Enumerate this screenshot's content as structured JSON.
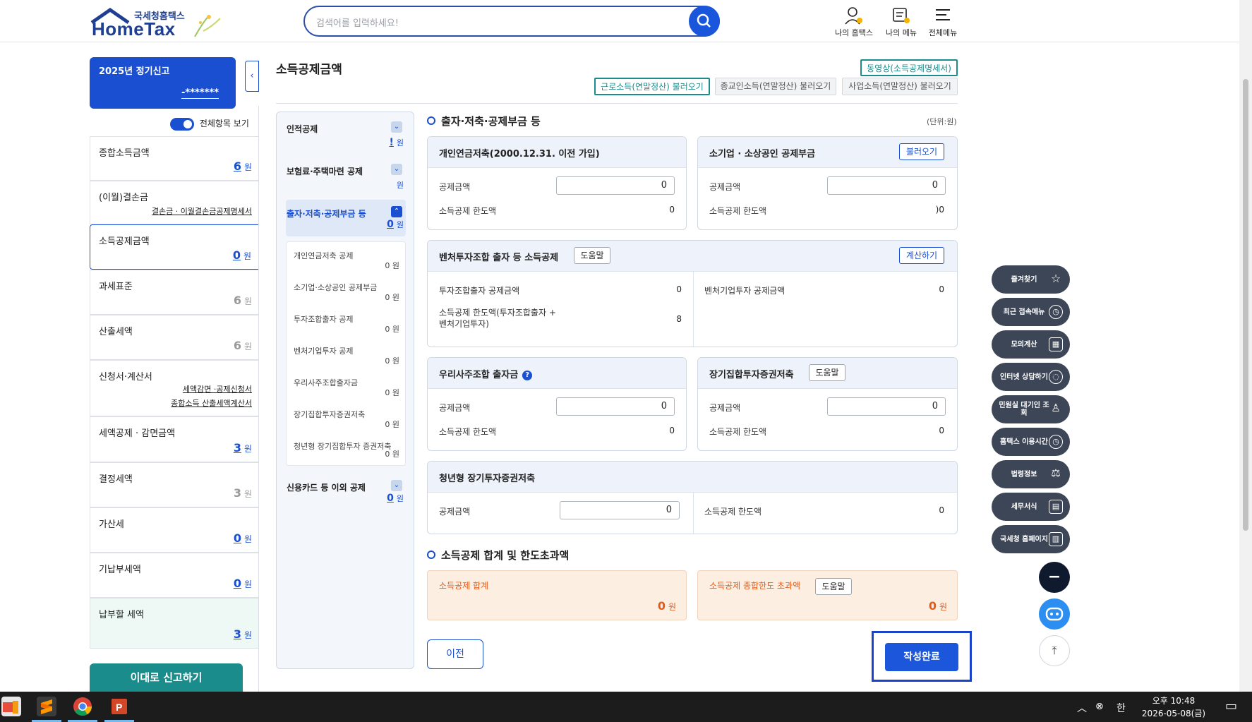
{
  "header": {
    "logo_small": "국세청홈택스",
    "logo_big": "HomeTax",
    "search_placeholder": "검색어를 입력하세요!",
    "icons": [
      {
        "name": "my-hometax-icon",
        "label": "나의 홈택스"
      },
      {
        "name": "my-menu-icon",
        "label": "나의 메뉴"
      },
      {
        "name": "all-menu-icon",
        "label": "전체메뉴"
      }
    ]
  },
  "sidebar": {
    "card_title": "2025년 정기신고",
    "card_masked": "-*******",
    "collapse_glyph": "‹",
    "toggle_label": "전체항목 보기",
    "won": "원",
    "items": [
      {
        "label": "종합소득금액",
        "value": "6"
      },
      {
        "label": "(이월)결손금",
        "link": "결손금 · 이월결손금공제명세서"
      },
      {
        "label": "소득공제금액",
        "value": "0"
      },
      {
        "label": "과세표준",
        "value": "6"
      },
      {
        "label": "산출세액",
        "value": "6"
      },
      {
        "label": "신청서·계산서",
        "link1": "세액감면 ·공제신청서",
        "link2": "종합소득 산출세액계산서"
      },
      {
        "label": "세액공제 · 감면금액",
        "value": "3"
      },
      {
        "label": "결정세액",
        "value": "3"
      },
      {
        "label": "가산세",
        "value": "0"
      },
      {
        "label": "기납부세액",
        "value": "0"
      },
      {
        "label": "납부할 세액",
        "value": "3"
      }
    ],
    "report_button": "이대로 신고하기"
  },
  "main": {
    "title": "소득공제금액",
    "video_button": "동영상(소득공제명세서)",
    "load_buttons": [
      "근로소득(연말정산) 불러오기",
      "종교인소득(연말정산) 불러오기",
      "사업소득(연말정산) 불러오기"
    ],
    "unit": "(단위:원)",
    "section1_title": "출자·저축·공제부금 등",
    "section2_title": "소득공제 합계 및 한도초과액",
    "boxes": {
      "pension": {
        "title": "개인연금저축(2000.12.31. 이전 가입)",
        "amount_label": "공제금액",
        "amount": "0",
        "limit_label": "소득공제 한도액",
        "limit": "0"
      },
      "small_biz": {
        "title": "소기업 · 소상공인 공제부금",
        "button": "불러오기",
        "amount_label": "공제금액",
        "amount": "0",
        "limit_label": "소득공제 한도액",
        "limit": ")0"
      },
      "venture": {
        "title": "벤처투자조합 출자 등 소득공제",
        "help": "도움말",
        "calc": "계산하기",
        "invest_label": "투자조합출자 공제금액",
        "invest": "0",
        "venture_label": "벤처기업투자 공제금액",
        "venture_val": "0",
        "limit_label": "소득공제 한도액(투자조합출자 + 벤처기업투자)",
        "limit": "8"
      },
      "esop": {
        "title": "우리사주조합 출자금",
        "help_glyph": "?",
        "amount_label": "공제금액",
        "amount": "0",
        "limit_label": "소득공제 한도액",
        "limit": "0"
      },
      "longterm": {
        "title": "장기집합투자증권저축",
        "help": "도움말",
        "amount_label": "공제금액",
        "amount": "0",
        "limit_label": "소득공제 한도액",
        "limit": "0"
      },
      "youth": {
        "title": "청년형 장기투자증권저축",
        "amount_label": "공제금액",
        "amount": "0",
        "limit_label": "소득공제 한도액",
        "limit": "0"
      }
    },
    "total": {
      "label": "소득공제 합계",
      "value": "0",
      "unit": "원"
    },
    "excess": {
      "label": "소득공제 종합한도 초과액",
      "help": "도움말",
      "value": "0",
      "unit": "원"
    },
    "prev_button": "이전",
    "done_button": "작성완료"
  },
  "midpanel": {
    "sections": [
      {
        "label": "인적공제",
        "value": "!",
        "unit": "원"
      },
      {
        "label": "보험료·주택마련 공제",
        "value": "",
        "unit": "원"
      },
      {
        "label": "출자·저축·공제부금 등",
        "value": "0",
        "unit": "원"
      },
      {
        "label": "신용카드 등 이외 공제",
        "value": "0",
        "unit": "원"
      }
    ],
    "sub_items": [
      {
        "label": "개인연금저축 공제",
        "value": "0 원"
      },
      {
        "label": "소기업·소상공인 공제부금",
        "value": "0 원"
      },
      {
        "label": "투자조합출자 공제",
        "value": "0 원"
      },
      {
        "label": "벤처기업투자 공제",
        "value": "0 원"
      },
      {
        "label": "우리사주조합출자금",
        "value": "0 원"
      },
      {
        "label": "장기집합투자증권저축",
        "value": "0 원"
      },
      {
        "label": "청년형 장기집합투자 증권저축",
        "value": "0 원"
      }
    ]
  },
  "floating": [
    {
      "label": "즐겨찾기",
      "icon": "☆"
    },
    {
      "label": "최근 접속메뉴",
      "icon": "◷"
    },
    {
      "label": "모의계산",
      "icon": "▦"
    },
    {
      "label": "인터넷 상담하기",
      "icon": "◌"
    },
    {
      "label": "민원실 대기인 조회",
      "icon": "♙"
    },
    {
      "label": "홈택스 이용시간",
      "icon": "◷"
    },
    {
      "label": "법령정보",
      "icon": "⚖"
    },
    {
      "label": "세무서식",
      "icon": "▤"
    },
    {
      "label": "국세청 홈페이지",
      "icon": "▥"
    }
  ],
  "round_buttons": {
    "minus": "−",
    "top": "⤒"
  },
  "taskbar": {
    "time": "오후 10:48",
    "date": "2026-05-08(금)",
    "ime": "한"
  },
  "colors": {
    "brand_blue": "#1b4fd1",
    "teal": "#1b8c8c",
    "orange": "#e45a1a"
  }
}
